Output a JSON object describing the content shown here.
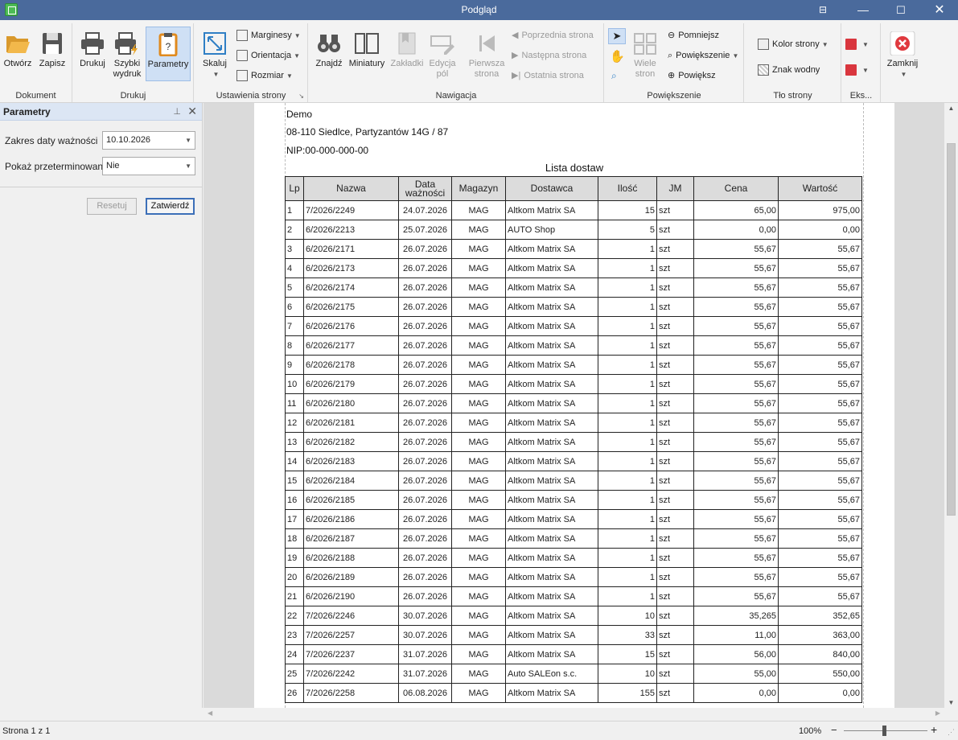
{
  "window": {
    "title": "Podgląd"
  },
  "ribbon": {
    "groups": {
      "dokument": "Dokument",
      "drukuj": "Drukuj",
      "ustawienia": "Ustawienia strony",
      "nawigacja": "Nawigacja",
      "powiekszenie": "Powiększenie",
      "tlo": "Tło strony",
      "eksport": "Eks..."
    },
    "buttons": {
      "otworz": "Otwórz",
      "zapisz": "Zapisz",
      "drukuj": "Drukuj",
      "szybki1": "Szybki",
      "szybki2": "wydruk",
      "parametry": "Parametry",
      "skaluj": "Skaluj",
      "marginesy": "Marginesy",
      "orientacja": "Orientacja",
      "rozmiar": "Rozmiar",
      "znajdz": "Znajdź",
      "miniatury": "Miniatury",
      "zakladki": "Zakładki",
      "edycja1": "Edycja",
      "edycja2": "pól",
      "pierwsza1": "Pierwsza",
      "pierwsza2": "strona",
      "poprzednia": "Poprzednia strona",
      "nastepna": "Następna strona",
      "ostatnia": "Ostatnia strona",
      "wiele1": "Wiele",
      "wiele2": "stron",
      "pomniejsz": "Pomniejsz",
      "powiekszenie": "Powiększenie",
      "powieksz": "Powiększ",
      "kolor": "Kolor strony",
      "znak": "Znak wodny",
      "zamknij": "Zamknij"
    }
  },
  "panel": {
    "title": "Parametry",
    "fields": [
      {
        "label": "Zakres daty ważności",
        "value": "10.10.2026"
      },
      {
        "label": "Pokaż przeterminowane",
        "value": "Nie"
      }
    ],
    "reset_label": "Resetuj",
    "submit_label": "Zatwierdź"
  },
  "report": {
    "company": "Demo",
    "address": "08-110 Siedlce, Partyzantów 14G / 87",
    "nip": "NIP:00-000-000-00",
    "title": "Lista dostaw",
    "columns": [
      "Lp",
      "Nazwa",
      "Data ważności",
      "Magazyn",
      "Dostawca",
      "Ilość",
      "JM",
      "Cena",
      "Wartość"
    ],
    "rows": [
      [
        "1",
        "7/2026/2249",
        "24.07.2026",
        "MAG",
        "Altkom Matrix SA",
        "15",
        "szt",
        "65,00",
        "975,00"
      ],
      [
        "2",
        "6/2026/2213",
        "25.07.2026",
        "MAG",
        "AUTO Shop",
        "5",
        "szt",
        "0,00",
        "0,00"
      ],
      [
        "3",
        "6/2026/2171",
        "26.07.2026",
        "MAG",
        "Altkom Matrix SA",
        "1",
        "szt",
        "55,67",
        "55,67"
      ],
      [
        "4",
        "6/2026/2173",
        "26.07.2026",
        "MAG",
        "Altkom Matrix SA",
        "1",
        "szt",
        "55,67",
        "55,67"
      ],
      [
        "5",
        "6/2026/2174",
        "26.07.2026",
        "MAG",
        "Altkom Matrix SA",
        "1",
        "szt",
        "55,67",
        "55,67"
      ],
      [
        "6",
        "6/2026/2175",
        "26.07.2026",
        "MAG",
        "Altkom Matrix SA",
        "1",
        "szt",
        "55,67",
        "55,67"
      ],
      [
        "7",
        "6/2026/2176",
        "26.07.2026",
        "MAG",
        "Altkom Matrix SA",
        "1",
        "szt",
        "55,67",
        "55,67"
      ],
      [
        "8",
        "6/2026/2177",
        "26.07.2026",
        "MAG",
        "Altkom Matrix SA",
        "1",
        "szt",
        "55,67",
        "55,67"
      ],
      [
        "9",
        "6/2026/2178",
        "26.07.2026",
        "MAG",
        "Altkom Matrix SA",
        "1",
        "szt",
        "55,67",
        "55,67"
      ],
      [
        "10",
        "6/2026/2179",
        "26.07.2026",
        "MAG",
        "Altkom Matrix SA",
        "1",
        "szt",
        "55,67",
        "55,67"
      ],
      [
        "11",
        "6/2026/2180",
        "26.07.2026",
        "MAG",
        "Altkom Matrix SA",
        "1",
        "szt",
        "55,67",
        "55,67"
      ],
      [
        "12",
        "6/2026/2181",
        "26.07.2026",
        "MAG",
        "Altkom Matrix SA",
        "1",
        "szt",
        "55,67",
        "55,67"
      ],
      [
        "13",
        "6/2026/2182",
        "26.07.2026",
        "MAG",
        "Altkom Matrix SA",
        "1",
        "szt",
        "55,67",
        "55,67"
      ],
      [
        "14",
        "6/2026/2183",
        "26.07.2026",
        "MAG",
        "Altkom Matrix SA",
        "1",
        "szt",
        "55,67",
        "55,67"
      ],
      [
        "15",
        "6/2026/2184",
        "26.07.2026",
        "MAG",
        "Altkom Matrix SA",
        "1",
        "szt",
        "55,67",
        "55,67"
      ],
      [
        "16",
        "6/2026/2185",
        "26.07.2026",
        "MAG",
        "Altkom Matrix SA",
        "1",
        "szt",
        "55,67",
        "55,67"
      ],
      [
        "17",
        "6/2026/2186",
        "26.07.2026",
        "MAG",
        "Altkom Matrix SA",
        "1",
        "szt",
        "55,67",
        "55,67"
      ],
      [
        "18",
        "6/2026/2187",
        "26.07.2026",
        "MAG",
        "Altkom Matrix SA",
        "1",
        "szt",
        "55,67",
        "55,67"
      ],
      [
        "19",
        "6/2026/2188",
        "26.07.2026",
        "MAG",
        "Altkom Matrix SA",
        "1",
        "szt",
        "55,67",
        "55,67"
      ],
      [
        "20",
        "6/2026/2189",
        "26.07.2026",
        "MAG",
        "Altkom Matrix SA",
        "1",
        "szt",
        "55,67",
        "55,67"
      ],
      [
        "21",
        "6/2026/2190",
        "26.07.2026",
        "MAG",
        "Altkom Matrix SA",
        "1",
        "szt",
        "55,67",
        "55,67"
      ],
      [
        "22",
        "7/2026/2246",
        "30.07.2026",
        "MAG",
        "Altkom Matrix SA",
        "10",
        "szt",
        "35,265",
        "352,65"
      ],
      [
        "23",
        "7/2026/2257",
        "30.07.2026",
        "MAG",
        "Altkom Matrix SA",
        "33",
        "szt",
        "11,00",
        "363,00"
      ],
      [
        "24",
        "7/2026/2237",
        "31.07.2026",
        "MAG",
        "Altkom Matrix SA",
        "15",
        "szt",
        "56,00",
        "840,00"
      ],
      [
        "25",
        "7/2026/2242",
        "31.07.2026",
        "MAG",
        "Auto SALEon s.c.",
        "10",
        "szt",
        "55,00",
        "550,00"
      ],
      [
        "26",
        "7/2026/2258",
        "06.08.2026",
        "MAG",
        "Altkom Matrix SA",
        "155",
        "szt",
        "0,00",
        "0,00"
      ]
    ]
  },
  "status": {
    "page": "Strona 1 z 1",
    "zoom": "100%"
  }
}
